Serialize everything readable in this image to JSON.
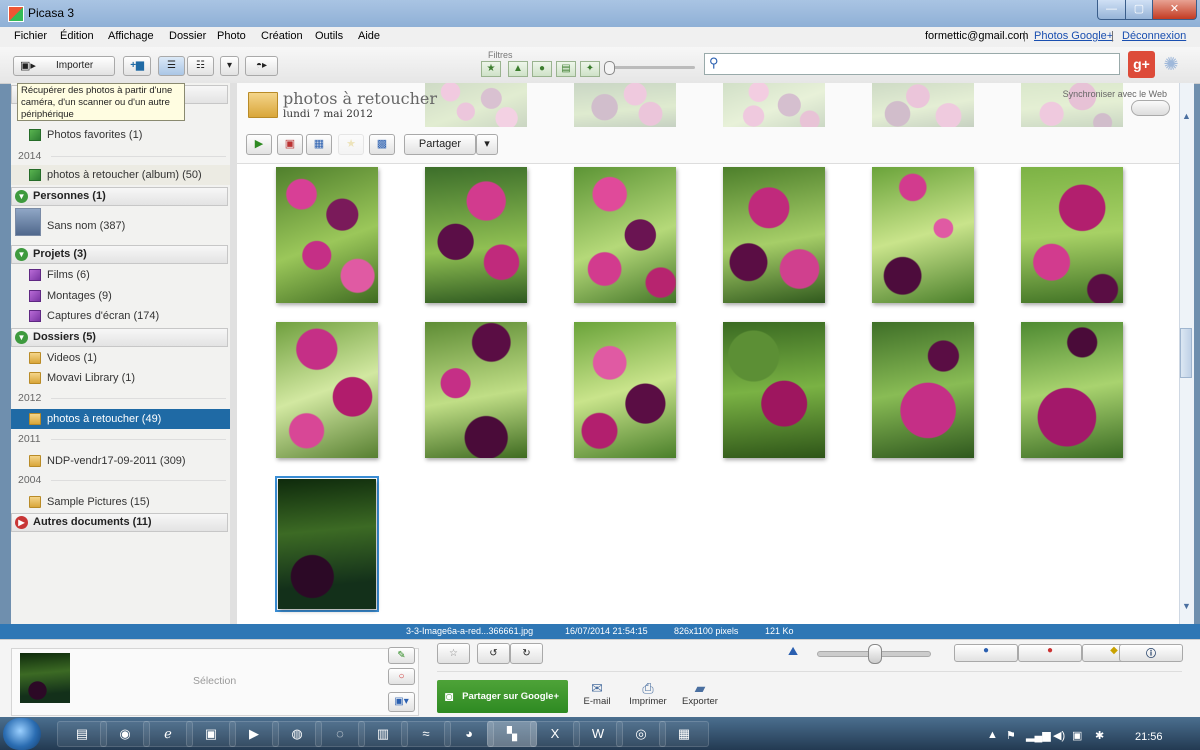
{
  "window": {
    "title": "Picasa 3",
    "min": "—",
    "max": "▢",
    "close": "✕"
  },
  "menu": [
    "Fichier",
    "Édition",
    "Affichage",
    "Dossier",
    "Photo",
    "Création",
    "Outils",
    "Aide"
  ],
  "account": {
    "email": "formettic@gmail.com",
    "sep": "|",
    "photos_link": "Photos Google+",
    "logout": "Déconnexion"
  },
  "toolbar": {
    "import_label": "Importer",
    "filters_label": "Filtres",
    "search_value": "",
    "gplus_label": "g+"
  },
  "tooltip": "Récupérer des photos à partir d'une caméra, d'un scanner ou d'un autre périphérique",
  "sidebar": {
    "favorites": "Photos favorites (1)",
    "year_2014": "2014",
    "album_retoucher": "photos à retoucher (album) (50)",
    "people_header": "Personnes (1)",
    "people_item": "Sans nom (387)",
    "projects_header": "Projets (3)",
    "films": "Films (6)",
    "montages": "Montages (9)",
    "captures": "Captures d'écran (174)",
    "folders_header": "Dossiers (5)",
    "videos": "Videos (1)",
    "movavi": "Movavi Library (1)",
    "year_2012": "2012",
    "folder_retoucher": "photos à retoucher (49)",
    "year_2011": "2011",
    "ndp": "NDP-vendr17-09-2011 (309)",
    "year_2004": "2004",
    "sample": "Sample Pictures (15)",
    "other_header": "Autres documents (11)"
  },
  "album": {
    "title": "photos à retoucher",
    "date": "lundi 7 mai 2012",
    "sync_label": "Synchroniser avec le Web",
    "share_label": "Partager"
  },
  "thumbnails": [
    "tulip-1",
    "tulip-2",
    "tulip-3",
    "tulip-4",
    "tulip-5",
    "tulip-6",
    "tulip-7",
    "tulip-8",
    "tulip-9",
    "tulip-10",
    "tulip-11",
    "tulip-12",
    "tulip-13"
  ],
  "status": {
    "filename": "3-3-Image6a-a-red...366661.jpg",
    "datetime": "16/07/2014 21:54:15",
    "dimensions": "826x1100 pixels",
    "size": "121 Ko"
  },
  "tray": {
    "selection_label": "Sélection",
    "gshare_label": "Partager sur Google+",
    "email_label": "E-mail",
    "print_label": "Imprimer",
    "export_label": "Exporter"
  },
  "taskbar": {
    "clock": "21:56"
  },
  "colors": {
    "selection": "#1f6aa5",
    "status_bar": "#2f77b5",
    "share_green": "#3a9a2c"
  }
}
